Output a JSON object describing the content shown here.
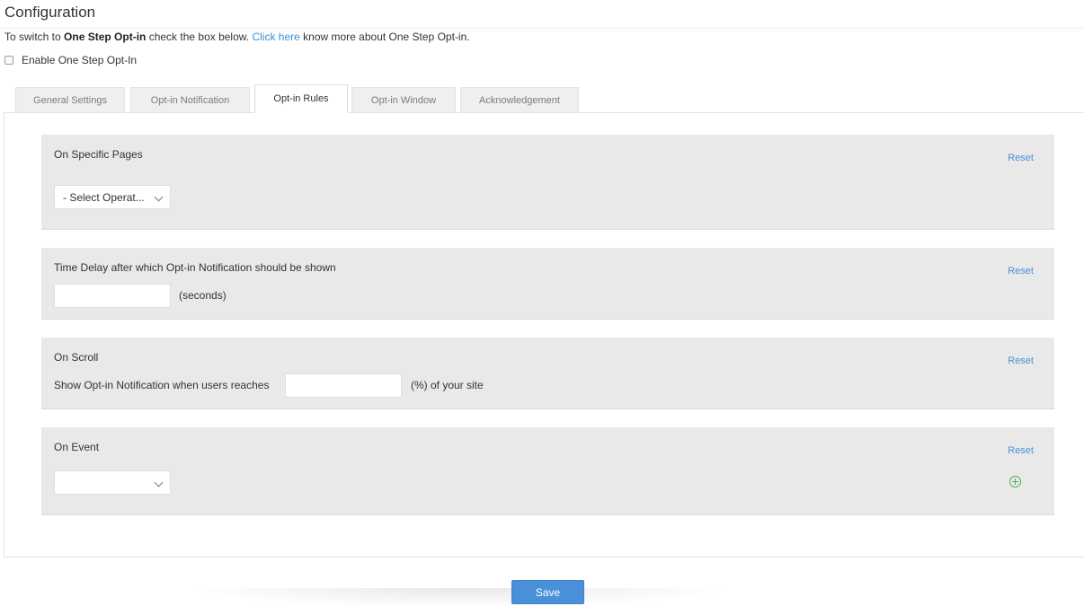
{
  "header": {
    "title": "Configuration",
    "intro_prefix": "To switch to ",
    "intro_bold": "One Step Opt-in",
    "intro_mid": " check the box below. ",
    "intro_link": "Click here",
    "intro_suffix": " know more about One Step Opt-in."
  },
  "enable": {
    "label": "Enable One Step Opt-In",
    "checked": false
  },
  "tabs": [
    {
      "label": "General Settings"
    },
    {
      "label": "Opt-in Notification"
    },
    {
      "label": "Opt-in Rules",
      "active": true
    },
    {
      "label": "Opt-in Window"
    },
    {
      "label": "Acknowledgement"
    }
  ],
  "sections": {
    "specific_pages": {
      "title": "On Specific Pages",
      "reset": "Reset",
      "select_value": "- Select Operat..."
    },
    "time_delay": {
      "title": "Time Delay after which Opt-in Notification should be shown",
      "reset": "Reset",
      "value": "",
      "unit": "(seconds)"
    },
    "scroll": {
      "title": "On Scroll",
      "reset": "Reset",
      "label": "Show Opt-in Notification when users reaches",
      "value": "",
      "unit": "(%) of your site"
    },
    "event": {
      "title": "On Event",
      "reset": "Reset",
      "select_value": ""
    }
  },
  "footer": {
    "save_label": "Save"
  },
  "colors": {
    "accent": "#4a90d9",
    "link": "#3b8fd6",
    "add": "#4caf50",
    "section_bg": "#e9e9e9"
  }
}
